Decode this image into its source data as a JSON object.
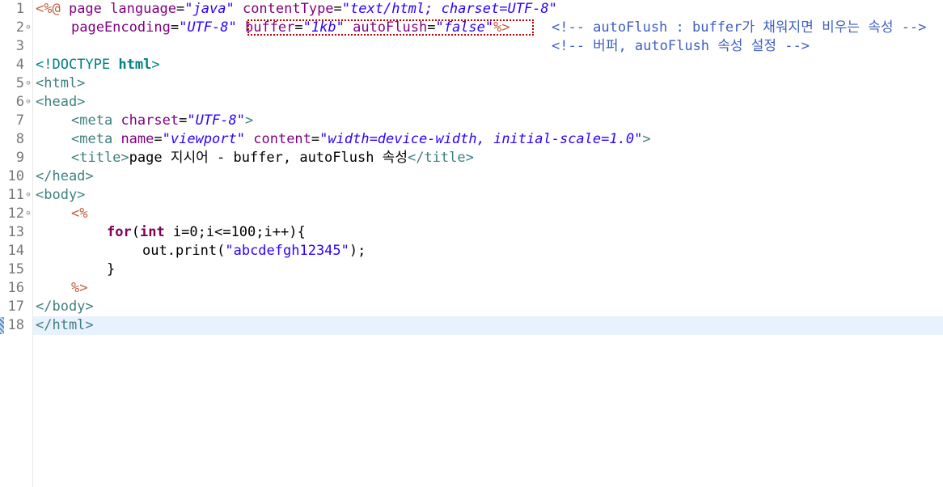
{
  "editor": {
    "line_numbers": [
      "1",
      "2",
      "3",
      "4",
      "5",
      "6",
      "7",
      "8",
      "9",
      "10",
      "11",
      "12",
      "13",
      "14",
      "15",
      "16",
      "17",
      "18"
    ],
    "fold_marker": "⊖",
    "l1": {
      "open": "<%@",
      "kw_page": " page ",
      "a1": "language",
      "eq1": "=",
      "v1": "\"java\"",
      "sp": " ",
      "a2": "contentType",
      "eq2": "=",
      "v2": "\"text/html; charset=UTF-8\""
    },
    "l2": {
      "a1": "pageEncoding",
      "eq1": "=",
      "v1": "\"UTF-8\"",
      "a2": "buffer",
      "eq2": "=",
      "v2": "\"1kb\"",
      "a3": "autoFlush",
      "eq3": "=",
      "v3": "\"false\"",
      "close": "%>",
      "comment": "<!-- autoFlush : buffer가 채워지면 비우는 속성 -->"
    },
    "l3": {
      "comment": "<!-- 버퍼, autoFlush 속성 설정 -->"
    },
    "l4": {
      "doctype": "<!DOCTYPE",
      "html": " html",
      "close": ">"
    },
    "l5": {
      "tag": "<html>"
    },
    "l6": {
      "tag": "<head>"
    },
    "l7": {
      "t1": "<meta",
      "a1": "charset",
      "eq": "=",
      "v1": "\"UTF-8\"",
      "t2": ">"
    },
    "l8": {
      "t1": "<meta",
      "a1": "name",
      "eq1": "=",
      "v1": "\"viewport\"",
      "a2": "content",
      "eq2": "=",
      "v2": "\"width=device-width, initial-scale=1.0\"",
      "t2": ">"
    },
    "l9": {
      "t1": "<title>",
      "text": "page 지시어 - buffer, autoFlush 속성",
      "t2": "</title>"
    },
    "l10": {
      "tag": "</head>"
    },
    "l11": {
      "tag": "<body>"
    },
    "l12": {
      "open": "<%"
    },
    "l13": {
      "kw_for": "for",
      "p1": "(",
      "kw_int": "int",
      "rest": " i=0;i<=100;i++){"
    },
    "l14": {
      "pre": "out.print(",
      "str": "\"abcdefgh12345\"",
      "post": ");"
    },
    "l15": {
      "brace": "}"
    },
    "l16": {
      "close": "%>"
    },
    "l17": {
      "tag": "</body>"
    },
    "l18": {
      "tag": "</html>"
    }
  }
}
